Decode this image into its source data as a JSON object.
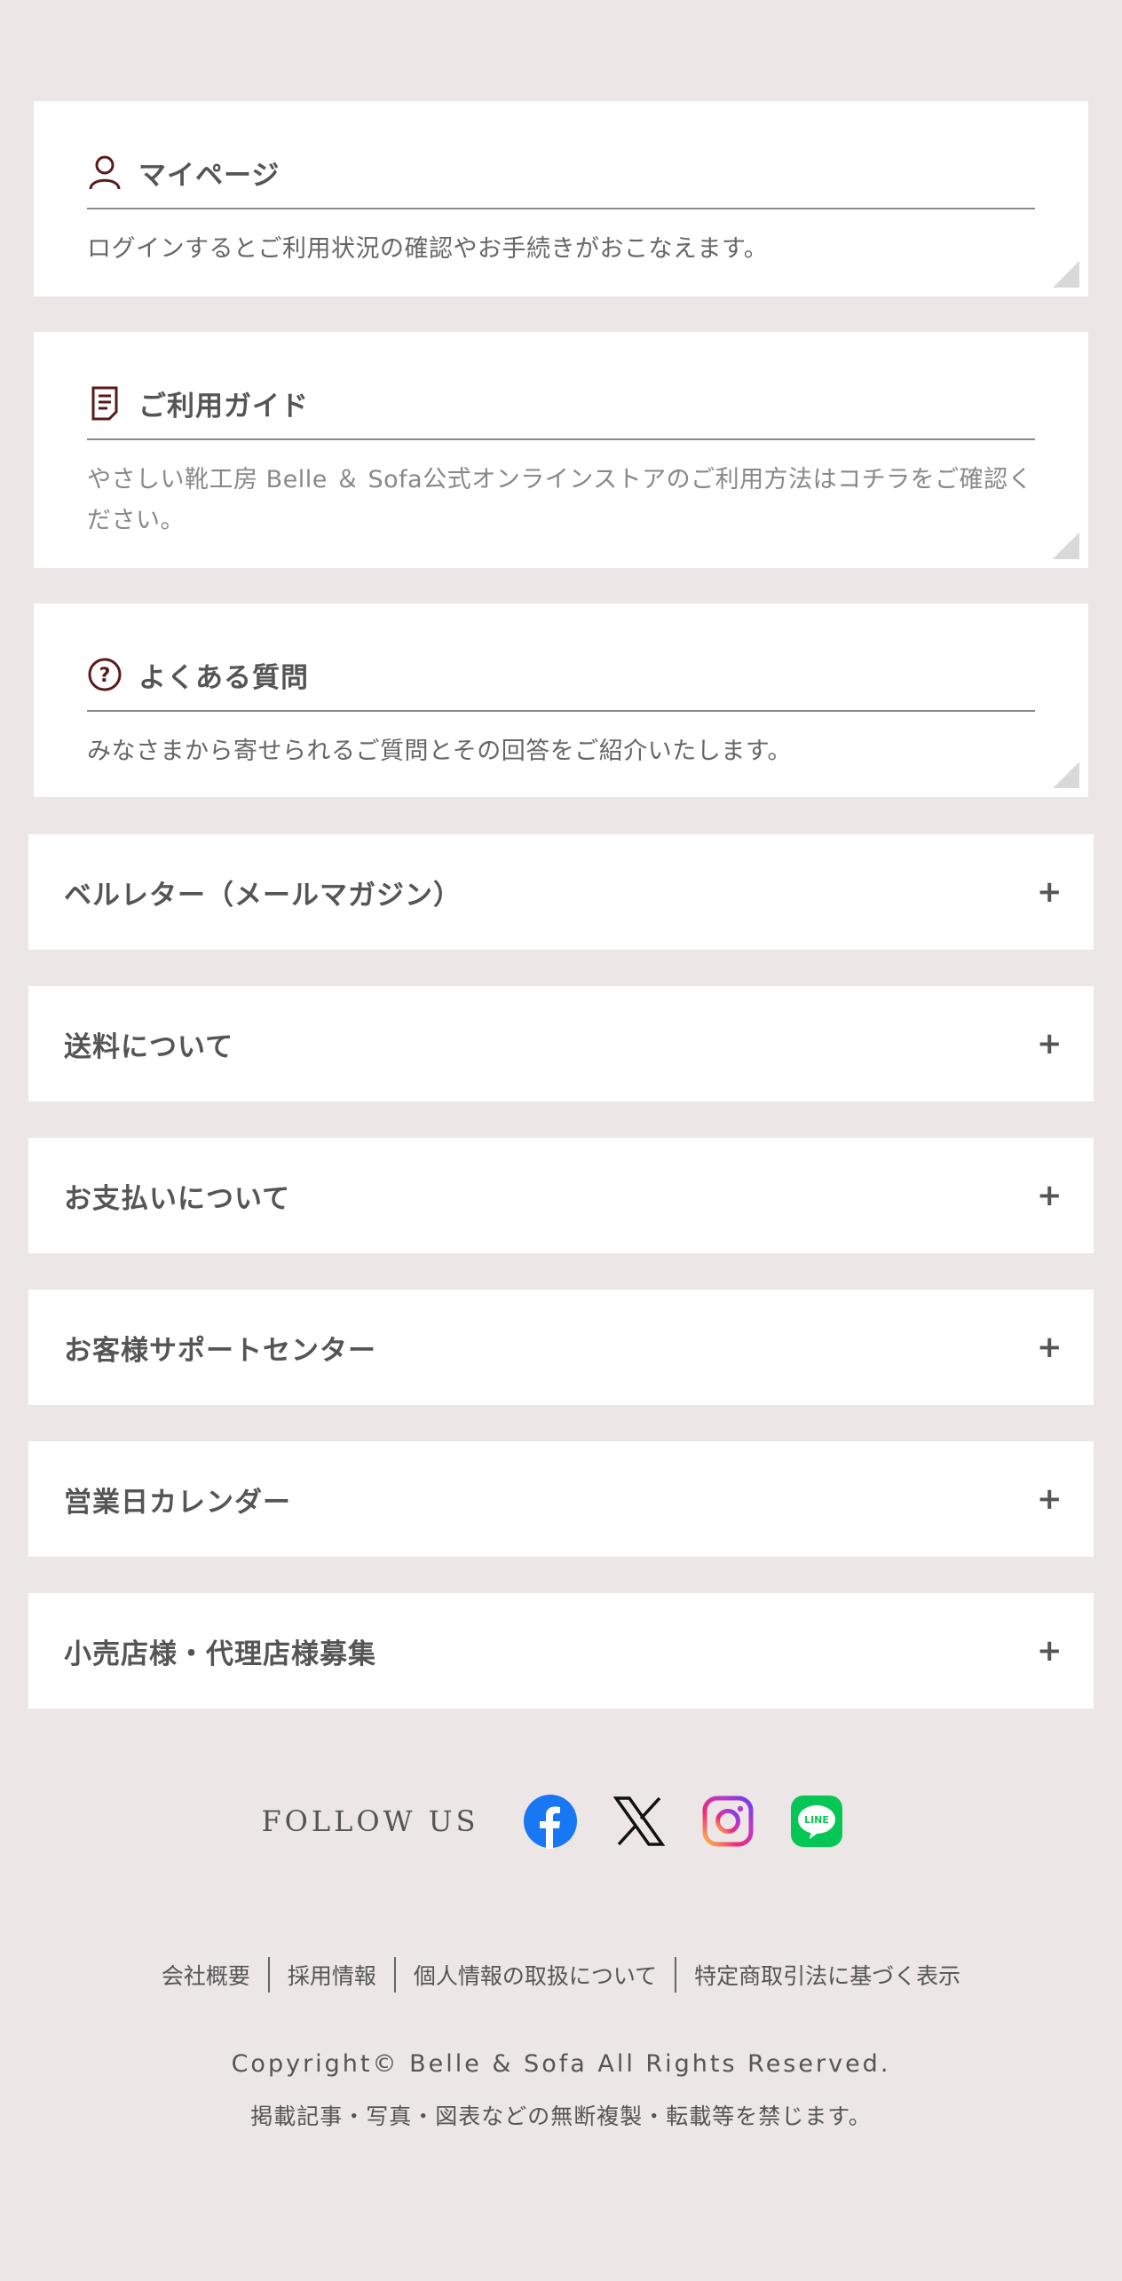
{
  "cards": [
    {
      "title": "マイページ",
      "desc": "ログインするとご利用状況の確認やお手続きがおこなえます。",
      "icon": "user-icon"
    },
    {
      "title": "ご利用ガイド",
      "desc": "やさしい靴工房 Belle ＆ Sofa公式オンラインストアのご利用方法はコチラをご確認ください。",
      "icon": "document-icon"
    },
    {
      "title": "よくある質問",
      "desc": "みなさまから寄せられるご質問とその回答をご紹介いたします。",
      "icon": "question-icon"
    }
  ],
  "accordions": [
    {
      "label": "ベルレター（メールマガジン）"
    },
    {
      "label": "送料について"
    },
    {
      "label": "お支払いについて"
    },
    {
      "label": "お客様サポートセンター"
    },
    {
      "label": "営業日カレンダー"
    },
    {
      "label": "小売店様・代理店様募集"
    }
  ],
  "accordion_toggle": "+",
  "follow": {
    "label": "FOLLOW US",
    "icons": [
      "facebook-icon",
      "x-icon",
      "instagram-icon",
      "line-icon"
    ],
    "line_text": "LINE"
  },
  "footer_links": [
    "会社概要",
    "採用情報",
    "個人情報の取扱について",
    "特定商取引法に基づく表示"
  ],
  "copyright": "Copyright© Belle & Sofa All Rights Reserved.",
  "notice": "掲載記事・写真・図表などの無断複製・転載等を禁じます。",
  "colors": {
    "background": "#ede6e6",
    "icon_accent": "#5a1a1a",
    "facebook": "#1877f2",
    "line": "#06c755"
  }
}
